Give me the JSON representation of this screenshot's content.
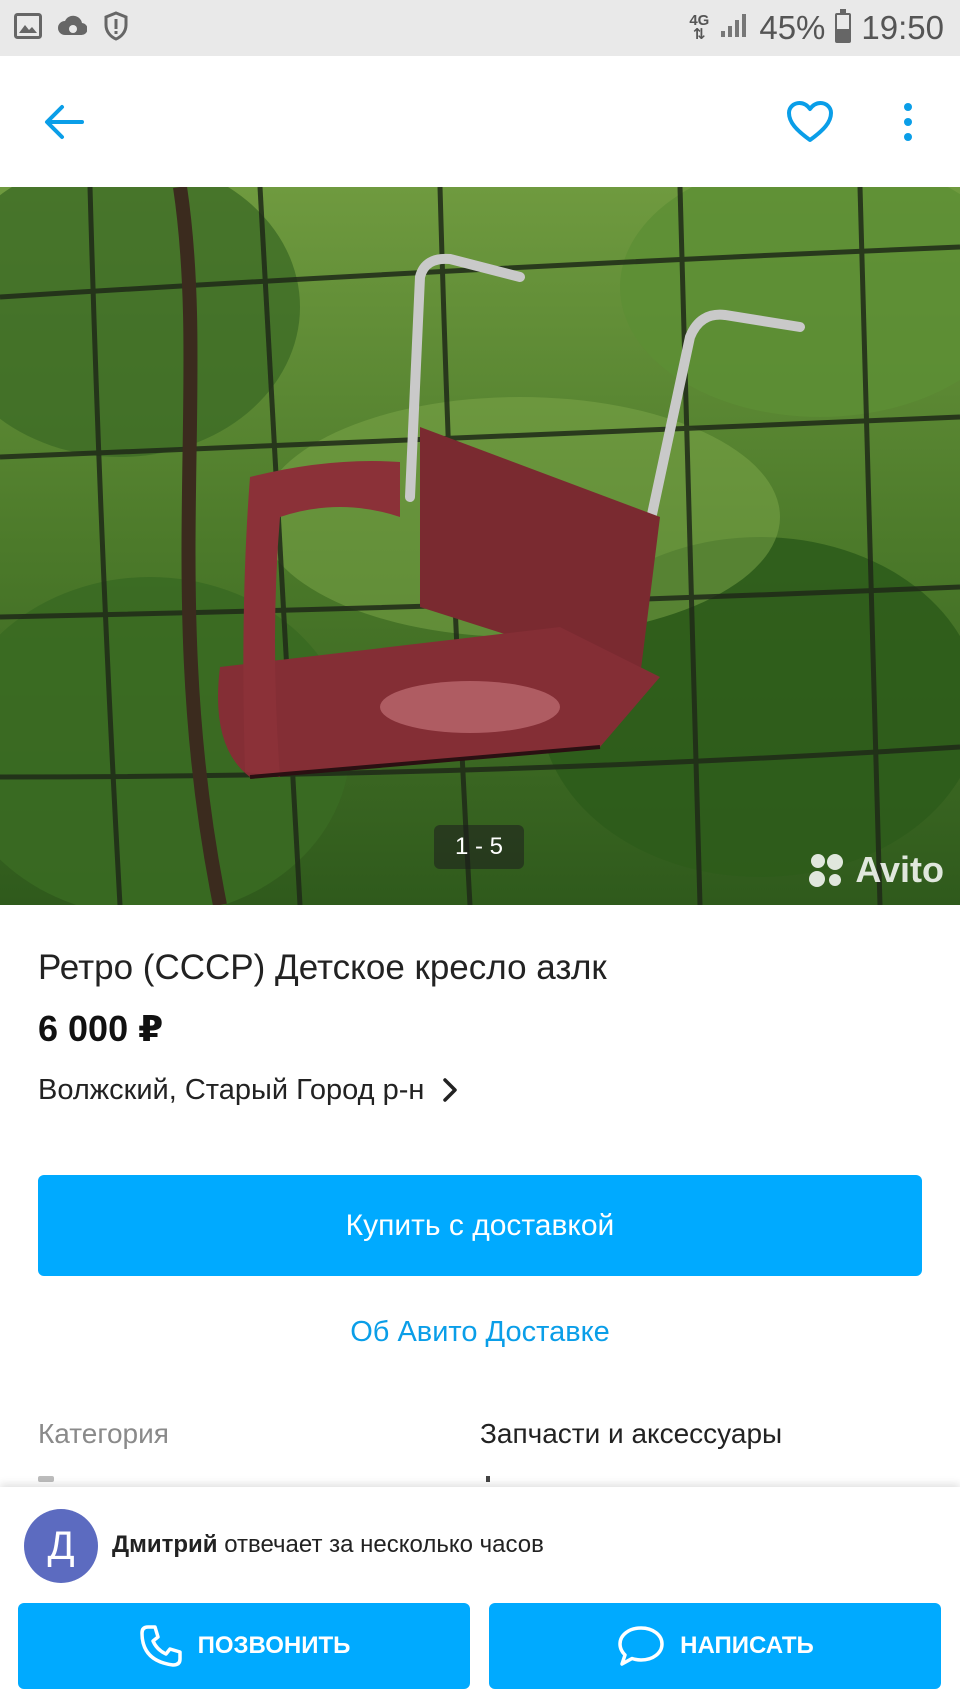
{
  "status_bar": {
    "network_type": "4G",
    "battery_percent": "45%",
    "battery_level": 0.45,
    "time": "19:50",
    "icons": [
      "gallery-icon",
      "cloud-sync-icon",
      "shield-alert-icon",
      "signal-icon",
      "battery-icon"
    ]
  },
  "app_bar": {
    "back_icon": "arrow-back-icon",
    "favorite_icon": "heart-outline-icon",
    "more_icon": "more-vertical-icon"
  },
  "photo": {
    "counter": "1 - 5",
    "watermark": "Avito",
    "description_icon": "product-photo"
  },
  "listing": {
    "title": "Ретро (СССР) Детское кресло азлк",
    "price": "6 000 ₽",
    "location": "Волжский, Старый Город р-н"
  },
  "actions": {
    "buy_label": "Купить с доставкой",
    "delivery_link": "Об Авито Доставке"
  },
  "params": [
    {
      "key": "Категория",
      "value": "Запчасти и аксессуары"
    }
  ],
  "seller": {
    "initial": "Д",
    "name": "Дмитрий",
    "response_text": "отвечает за несколько часов"
  },
  "contact": {
    "call_label": "ПОЗВОНИТЬ",
    "write_label": "НАПИСАТЬ"
  },
  "colors": {
    "accent": "#00aaff",
    "link": "#0a9ee8",
    "avatar": "#5c6bc0",
    "status_bar": "#e9e9e9"
  }
}
